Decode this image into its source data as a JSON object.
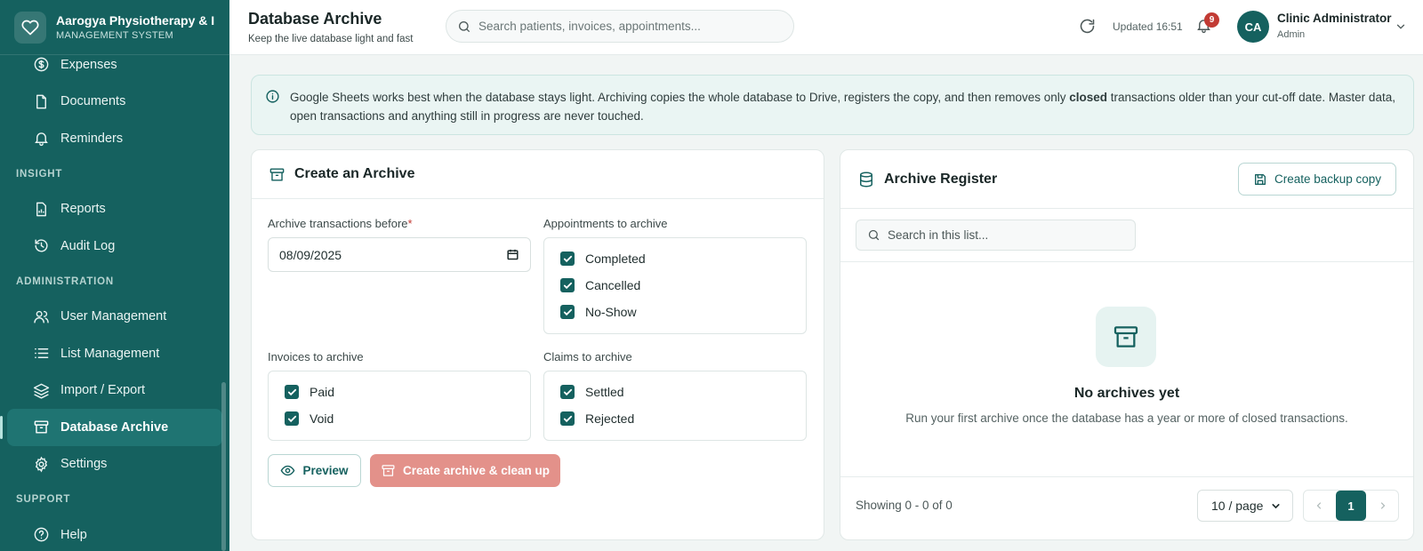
{
  "brand": {
    "name": "Aarogya Physiotherapy & I",
    "subtitle": "MANAGEMENT SYSTEM"
  },
  "sidebar": {
    "items_top": [
      {
        "label": "Expenses",
        "icon": "dollar-icon"
      },
      {
        "label": "Documents",
        "icon": "document-icon"
      },
      {
        "label": "Reminders",
        "icon": "bell-icon"
      }
    ],
    "section_insight": "INSIGHT",
    "items_insight": [
      {
        "label": "Reports",
        "icon": "report-icon"
      },
      {
        "label": "Audit Log",
        "icon": "history-icon"
      }
    ],
    "section_admin": "ADMINISTRATION",
    "items_admin": [
      {
        "label": "User Management",
        "icon": "users-icon"
      },
      {
        "label": "List Management",
        "icon": "list-icon"
      },
      {
        "label": "Import / Export",
        "icon": "layers-icon"
      },
      {
        "label": "Database Archive",
        "icon": "archive-icon",
        "active": true
      },
      {
        "label": "Settings",
        "icon": "gear-icon"
      }
    ],
    "section_support": "SUPPORT",
    "items_support": [
      {
        "label": "Help",
        "icon": "help-icon"
      }
    ]
  },
  "header": {
    "title": "Database Archive",
    "subtitle": "Keep the live database light and fast",
    "search_placeholder": "Search patients, invoices, appointments...",
    "updated": "Updated 16:51",
    "notification_count": "9",
    "user": {
      "initials": "CA",
      "name": "Clinic Administrator",
      "role": "Admin"
    }
  },
  "info": {
    "text_before": "Google Sheets works best when the database stays light. Archiving copies the whole database to Drive, registers the copy, and then removes only ",
    "text_bold": "closed",
    "text_after": " transactions older than your cut-off date. Master data, open transactions and anything still in progress are never touched."
  },
  "create_archive": {
    "title": "Create an Archive",
    "date_label": "Archive transactions before",
    "required_mark": "*",
    "date_value": "08/09/2025",
    "appointments_label": "Appointments to archive",
    "appointments": [
      {
        "label": "Completed",
        "checked": true
      },
      {
        "label": "Cancelled",
        "checked": true
      },
      {
        "label": "No-Show",
        "checked": true
      }
    ],
    "invoices_label": "Invoices to archive",
    "invoices": [
      {
        "label": "Paid",
        "checked": true
      },
      {
        "label": "Void",
        "checked": true
      }
    ],
    "claims_label": "Claims to archive",
    "claims": [
      {
        "label": "Settled",
        "checked": true
      },
      {
        "label": "Rejected",
        "checked": true
      }
    ],
    "preview_button": "Preview",
    "create_button": "Create archive & clean up"
  },
  "register": {
    "title": "Archive Register",
    "backup_button": "Create backup copy",
    "search_placeholder": "Search in this list...",
    "empty_title": "No archives yet",
    "empty_desc": "Run your first archive once the database has a year or more of closed transactions.",
    "showing": "Showing 0 - 0 of 0",
    "page_size": "10 / page",
    "current_page": "1"
  },
  "colors": {
    "primary": "#15615f",
    "danger_disabled": "#e3918a",
    "badge": "#c23b34"
  }
}
